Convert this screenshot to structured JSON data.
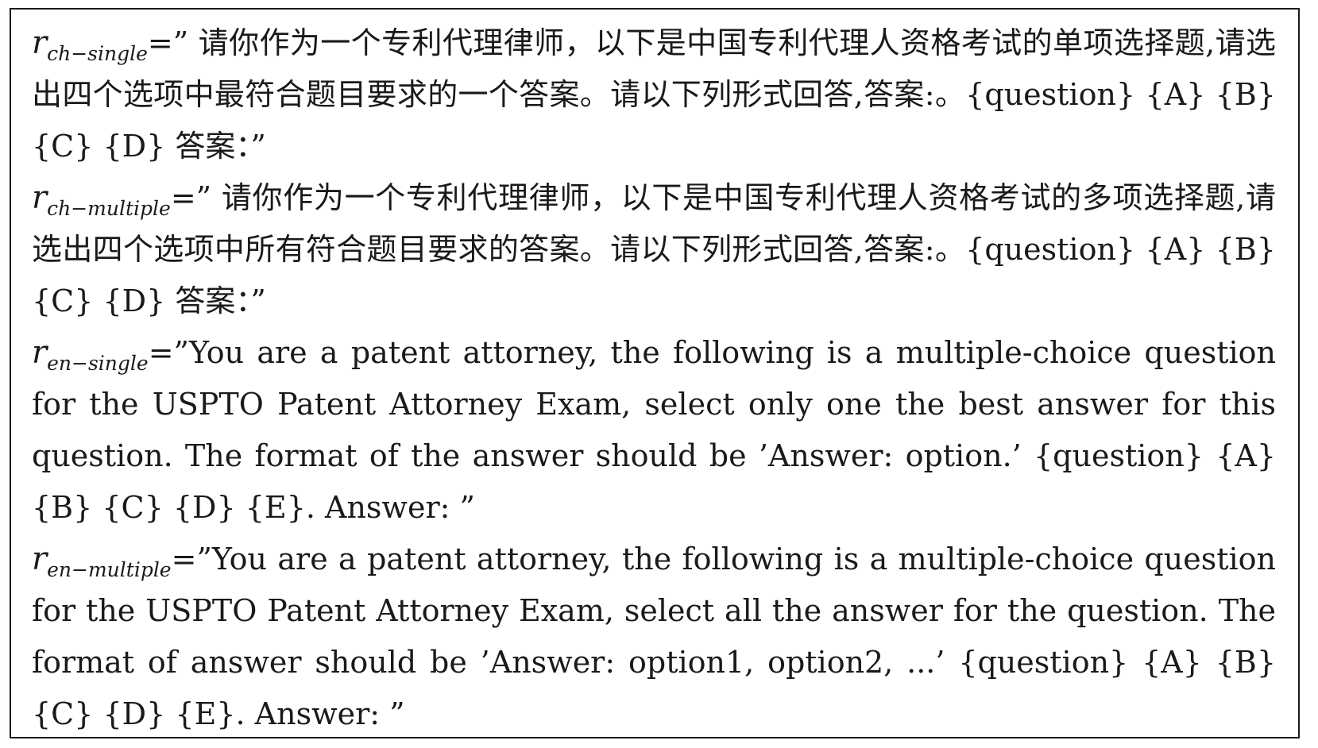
{
  "prompts": [
    {
      "var_base": "r",
      "var_sub": "ch−single",
      "equals": "=",
      "text": "” 请你作为一个专利代理律师，以下是中国专利代理人资格考试的单项选择题,请选出四个选项中最符合题目要求的一个答案。请以下列形式回答,答案:。{question} {A} {B} {C} {D} 答案：”"
    },
    {
      "var_base": "r",
      "var_sub": "ch−multiple",
      "equals": "=",
      "text": "” 请你作为一个专利代理律师，以下是中国专利代理人资格考试的多项选择题,请选出四个选项中所有符合题目要求的答案。请以下列形式回答,答案:。{question} {A} {B} {C} {D} 答案：”"
    },
    {
      "var_base": "r",
      "var_sub": "en−single",
      "equals": "=",
      "text": "”You are a patent attorney, the following is a multiple-choice question for the USPTO Patent Attorney Exam, select only one the best answer for this question. The format of the answer should be ’Answer: option.’ {question} {A} {B} {C} {D} {E}. Answer: ”"
    },
    {
      "var_base": "r",
      "var_sub": "en−multiple",
      "equals": "=",
      "text": "”You are a patent attorney, the following is a multiple-choice question for the USPTO Patent Attorney Exam, select all the answer for the question. The format of answer should be ’Answer: option1, option2, ...’ {question} {A} {B} {C} {D} {E}. Answer: ”"
    }
  ]
}
